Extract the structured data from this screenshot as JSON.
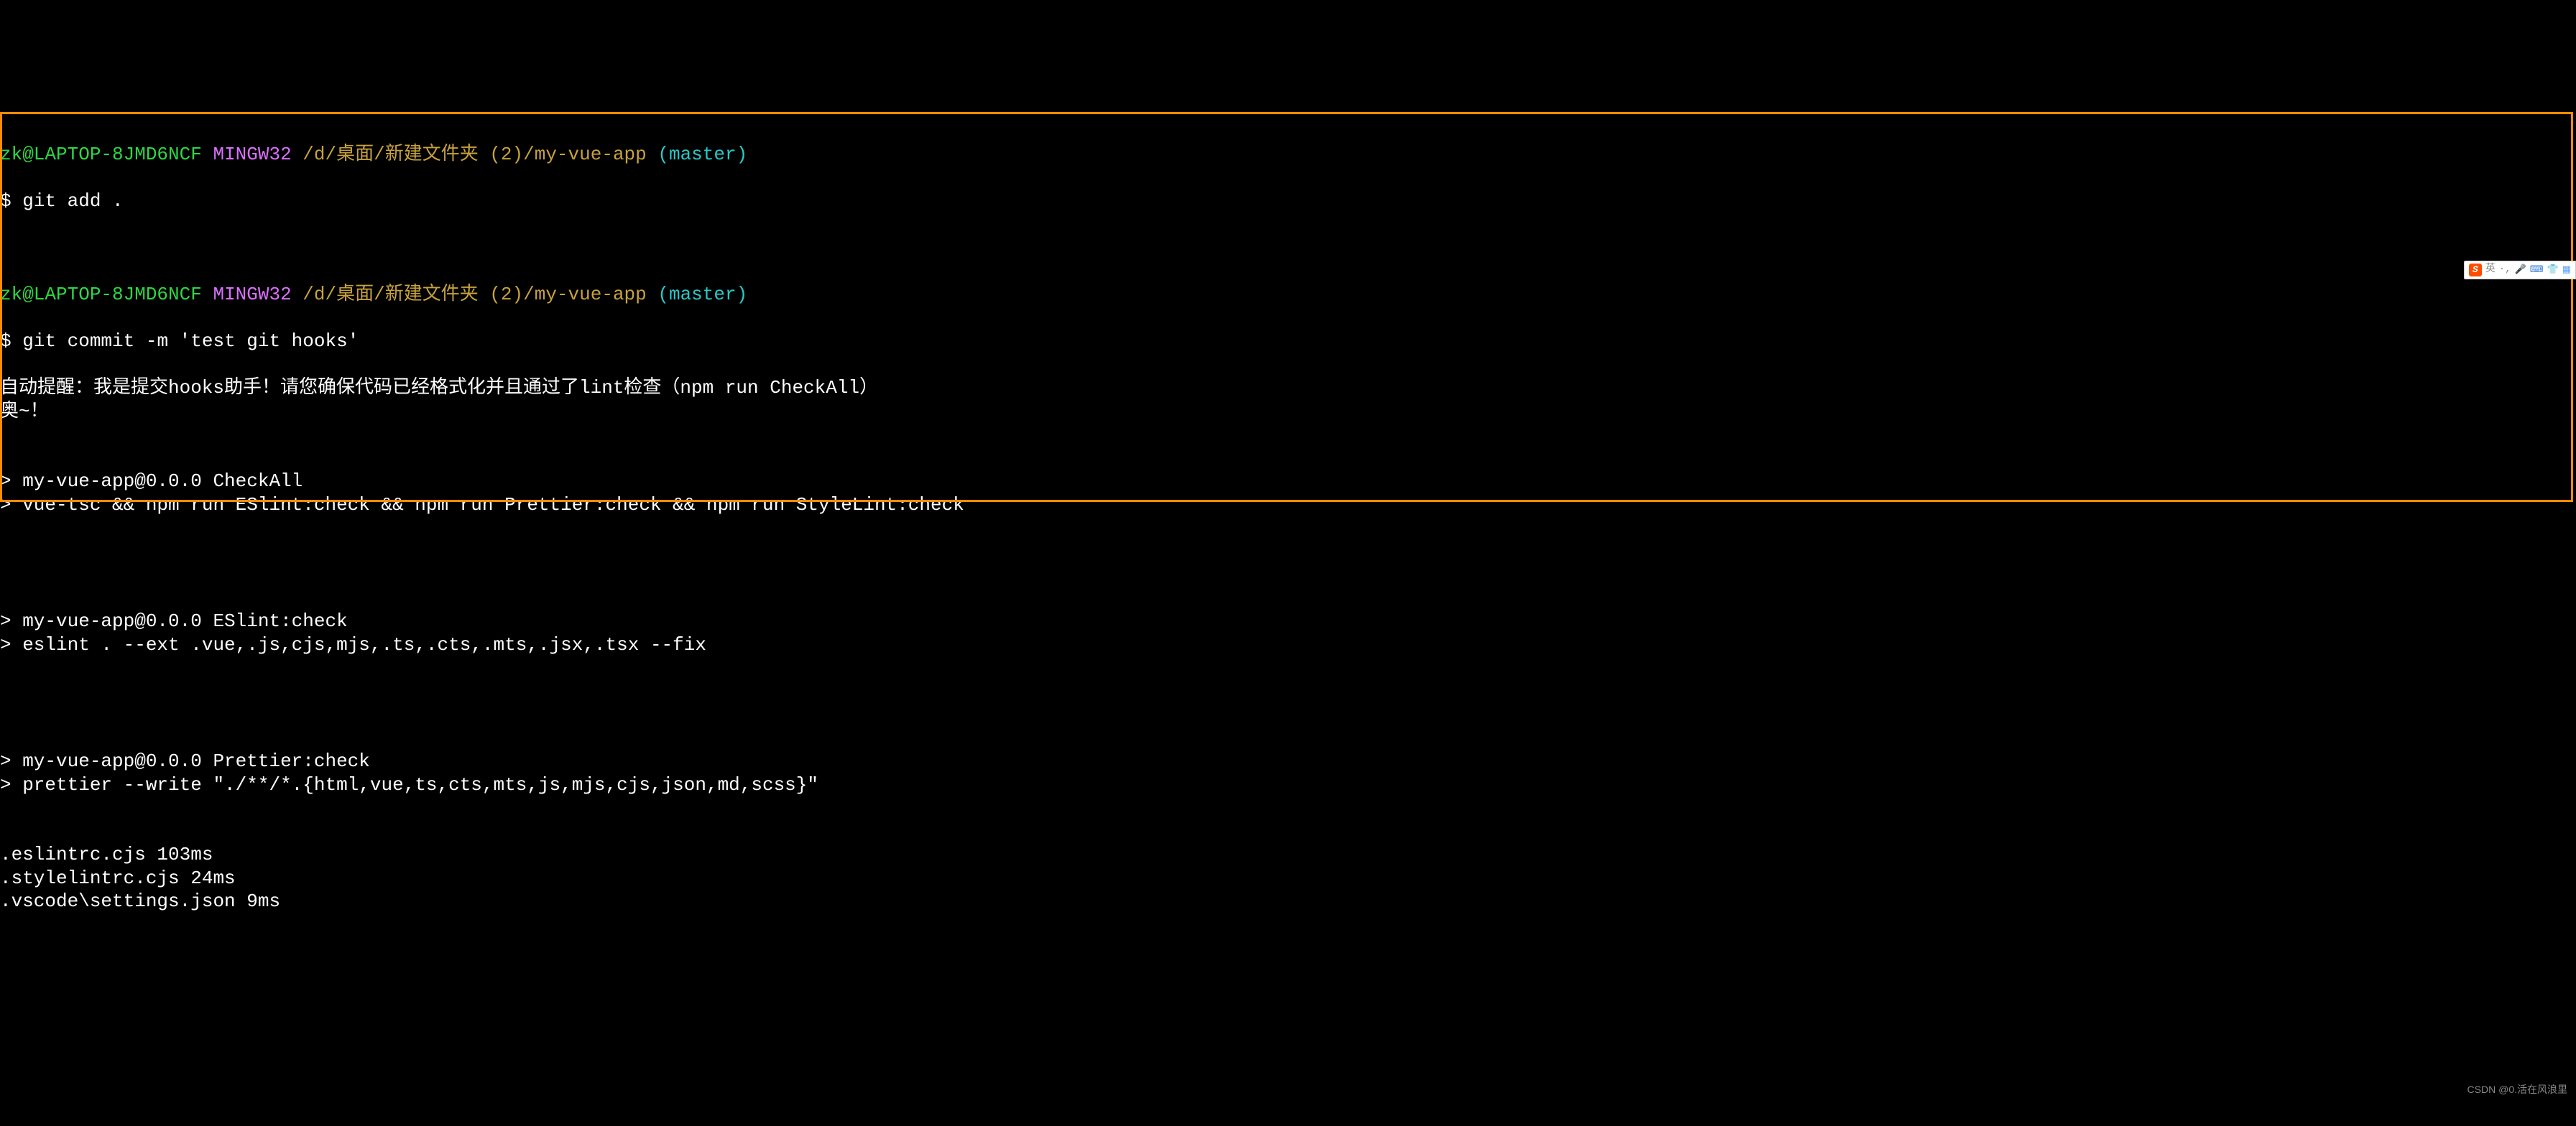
{
  "prompt1": {
    "user_host": "zk@LAPTOP-8JMD6NCF",
    "mingw": "MINGW32",
    "path": "/d/桌面/新建文件夹 (2)/my-vue-app",
    "branch": "(master)",
    "dollar": "$",
    "command": "git add ."
  },
  "prompt2": {
    "user_host": "zk@LAPTOP-8JMD6NCF",
    "mingw": "MINGW32",
    "path": "/d/桌面/新建文件夹 (2)/my-vue-app",
    "branch": "(master)",
    "dollar": "$",
    "command": "git commit -m 'test git hooks'"
  },
  "hook_msg_line1": "自动提醒：我是提交hooks助手！请您确保代码已经格式化并且通过了lint检查（npm run CheckAll）",
  "hook_msg_line2": "奥~！",
  "script1_line1": "> my-vue-app@0.0.0 CheckAll",
  "script1_line2": "> vue-tsc && npm run ESlint:check && npm run Prettier:check && npm run StyleLint:check",
  "script2_line1": "> my-vue-app@0.0.0 ESlint:check",
  "script2_line2": "> eslint . --ext .vue,.js,cjs,mjs,.ts,.cts,.mts,.jsx,.tsx --fix",
  "script3_line1": "> my-vue-app@0.0.0 Prettier:check",
  "script3_line2": "> prettier --write \"./**/*.{html,vue,ts,cts,mts,js,mjs,cjs,json,md,scss}\"",
  "file1": ".eslintrc.cjs 103ms",
  "file2": ".stylelintrc.cjs 24ms",
  "file3": ".vscode\\settings.json 9ms",
  "watermark": "CSDN @0.活在风浪里",
  "ime": {
    "logo": "S",
    "text": "英"
  }
}
